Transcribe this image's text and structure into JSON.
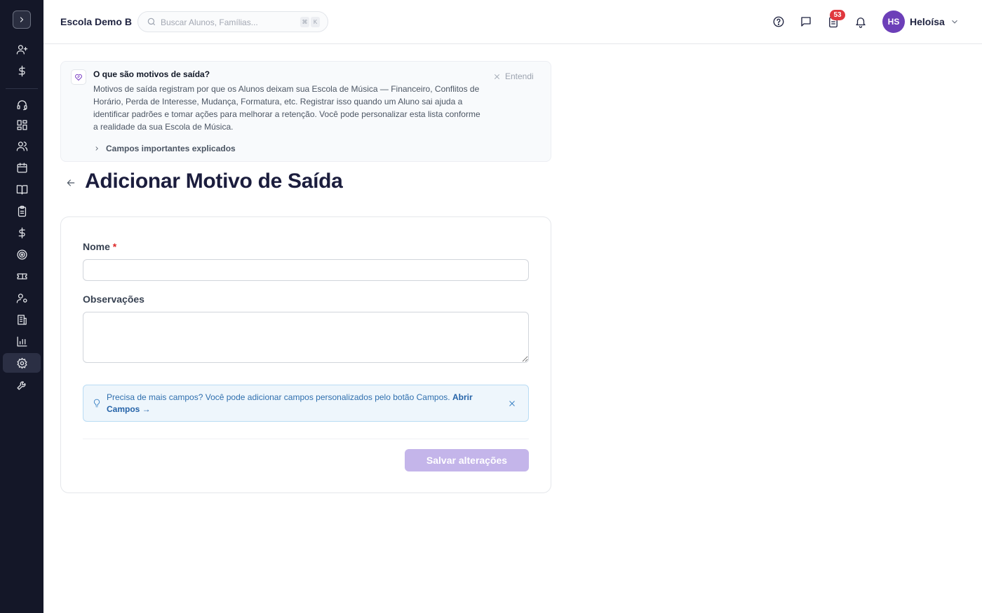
{
  "header": {
    "school_name": "Escola Demo B",
    "search_placeholder": "Buscar Alunos, Famílias...",
    "search_shortcut": [
      "⌘",
      "K"
    ],
    "tasks_badge": "53",
    "user": {
      "initials": "HS",
      "name": "Heloísa"
    }
  },
  "sidebar": {
    "items": [
      {
        "icon": "user-plus-icon"
      },
      {
        "icon": "dollar-icon"
      },
      {
        "icon": "headset-icon"
      },
      {
        "icon": "dashboard-icon"
      },
      {
        "icon": "users-icon"
      },
      {
        "icon": "calendar-icon"
      },
      {
        "icon": "book-open-icon"
      },
      {
        "icon": "clipboard-icon"
      },
      {
        "icon": "dollar-icon"
      },
      {
        "icon": "target-icon"
      },
      {
        "icon": "ticket-icon"
      },
      {
        "icon": "user-gear-icon"
      },
      {
        "icon": "building-icon"
      },
      {
        "icon": "bar-chart-icon"
      },
      {
        "icon": "settings-icon",
        "active": true
      },
      {
        "icon": "wrench-icon"
      }
    ]
  },
  "info": {
    "title": "O que são motivos de saída?",
    "body": "Motivos de saída registram por que os Alunos deixam sua Escola de Música — Financeiro, Conflitos de Horário, Perda de Interesse, Mudança, Formatura, etc. Registrar isso quando um Aluno sai ajuda a identificar padrões e tomar ações para melhorar a retenção. Você pode personalizar esta lista conforme a realidade da sua Escola de Música.",
    "dismiss_label": "Entendi",
    "expand_label": "Campos importantes explicados"
  },
  "page": {
    "title": "Adicionar Motivo de Saída"
  },
  "form": {
    "name_label": "Nome",
    "required_mark": "*",
    "name_value": "",
    "notes_label": "Observações",
    "notes_value": "",
    "hint_text": "Precisa de mais campos? Você pode adicionar campos personalizados pelo botão Campos.",
    "hint_link": "Abrir Campos →",
    "save_label": "Salvar alterações"
  },
  "colors": {
    "sidebar_bg": "#141728",
    "accent": "#6c3fb8",
    "save_disabled": "#c4b5ea",
    "badge": "#e0383e",
    "hint_bg": "#eef6fc"
  }
}
